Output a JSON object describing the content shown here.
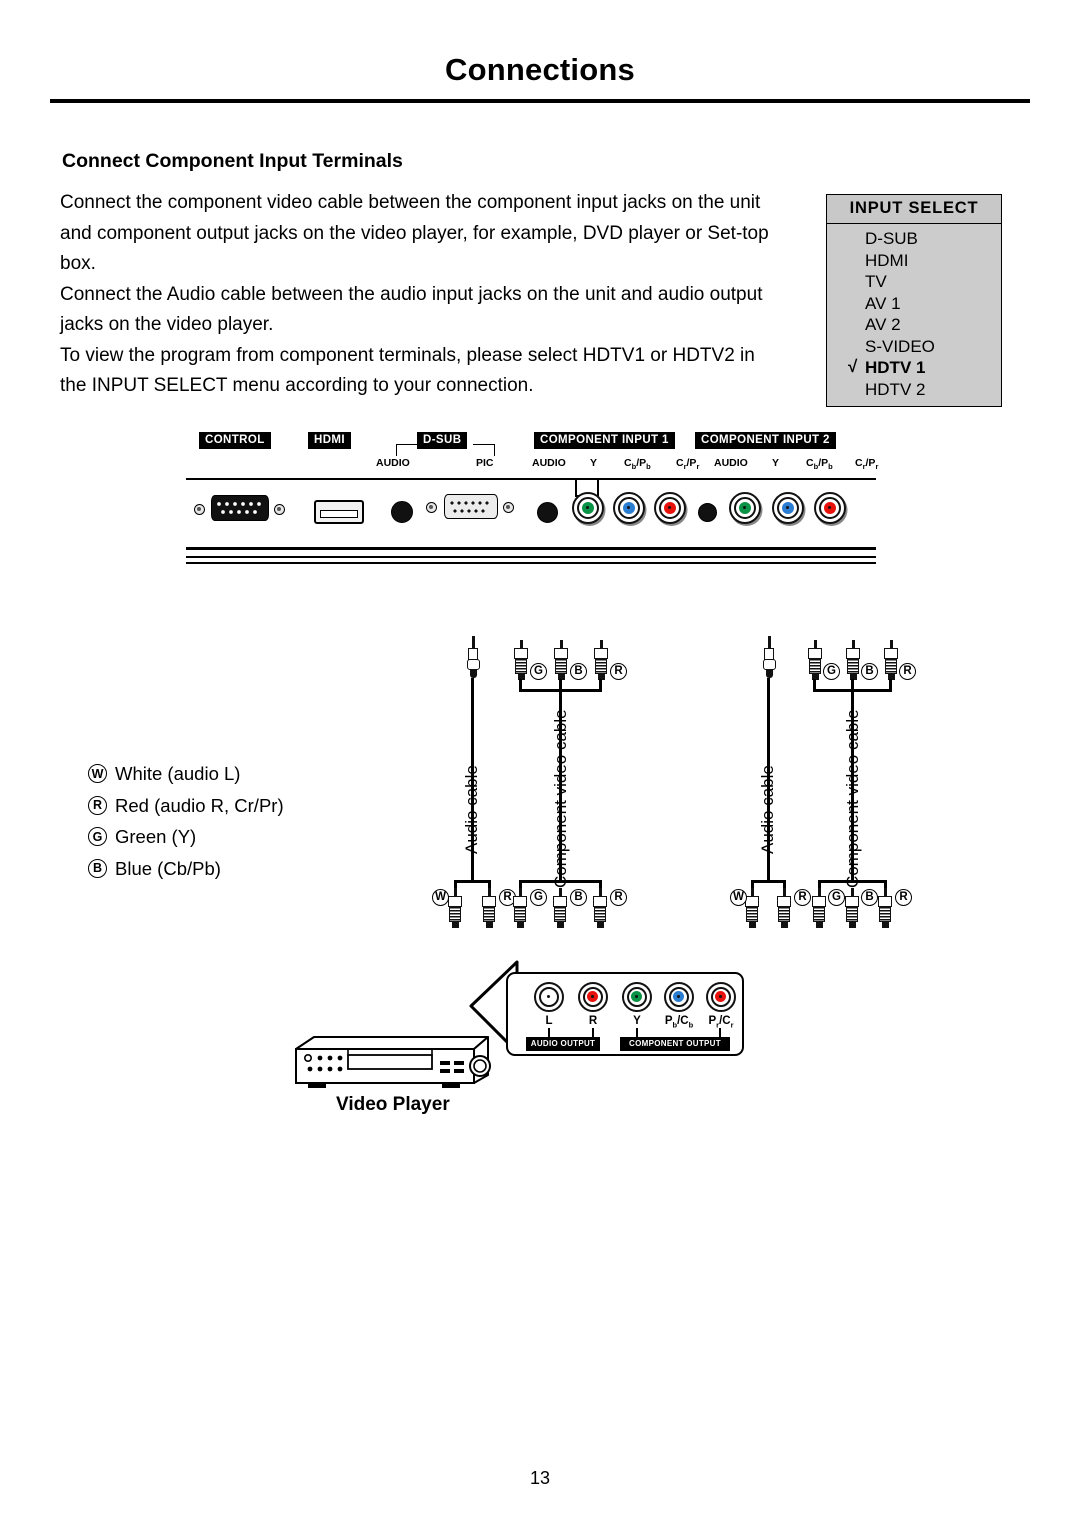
{
  "page": {
    "title": "Connections",
    "number": "13"
  },
  "section": {
    "heading": "Connect Component Input Terminals",
    "paragraphs": [
      "Connect the component video cable between the component input jacks on the unit and component output jacks on the video player, for example, DVD player or Set-top box.",
      "Connect the Audio cable between the audio input jacks on the unit and audio output jacks on the video player.",
      "To view the program from component terminals, please select HDTV1 or HDTV2 in the INPUT SELECT menu according to your connection."
    ]
  },
  "input_select": {
    "title": "INPUT SELECT",
    "check_mark": "√",
    "items": [
      {
        "label": "D-SUB",
        "selected": false
      },
      {
        "label": "HDMI",
        "selected": false
      },
      {
        "label": "TV",
        "selected": false
      },
      {
        "label": "AV 1",
        "selected": false
      },
      {
        "label": "AV 2",
        "selected": false
      },
      {
        "label": "S-VIDEO",
        "selected": false
      },
      {
        "label": "HDTV 1",
        "selected": true
      },
      {
        "label": "HDTV 2",
        "selected": false
      }
    ]
  },
  "rear_panel": {
    "tags": {
      "control": "CONTROL",
      "hdmi": "HDMI",
      "dsub": "D-SUB",
      "component1": "COMPONENT INPUT 1",
      "component2": "COMPONENT INPUT 2"
    },
    "sub_labels": {
      "dsub_audio": "AUDIO",
      "dsub_pic": "PIC",
      "c1_audio": "AUDIO",
      "c1_y": "Y",
      "c1_cb": "Cb/Pb",
      "c1_cr": "Cr/Pr",
      "c2_audio": "AUDIO",
      "c2_y": "Y",
      "c2_cb": "Cb/Pb",
      "c2_cr": "Cr/Pr"
    }
  },
  "legend": [
    {
      "code": "W",
      "text": "White (audio L)"
    },
    {
      "code": "R",
      "text": "Red (audio R, Cr/Pr)"
    },
    {
      "code": "G",
      "text": "Green (Y)"
    },
    {
      "code": "B",
      "text": "Blue (Cb/Pb)"
    }
  ],
  "cables": {
    "audio_label": "Audio cable",
    "component_label": "Component video cable",
    "audio_plug_codes": [
      "W",
      "R"
    ],
    "component_plug_codes": [
      "G",
      "B",
      "R"
    ]
  },
  "video_player": {
    "caption": "Video Player",
    "jacks": [
      "L",
      "R",
      "Y",
      "Pb/Cb",
      "Pr/Cr"
    ],
    "audio_output_tag": "AUDIO OUTPUT",
    "component_output_tag": "COMPONENT OUTPUT"
  },
  "colors": {
    "green": "#0a9246",
    "blue": "#2a7dd1",
    "red": "#e8120c",
    "white_jack": "#ffffff",
    "osd_background": "#cccccc",
    "black": "#000000"
  }
}
